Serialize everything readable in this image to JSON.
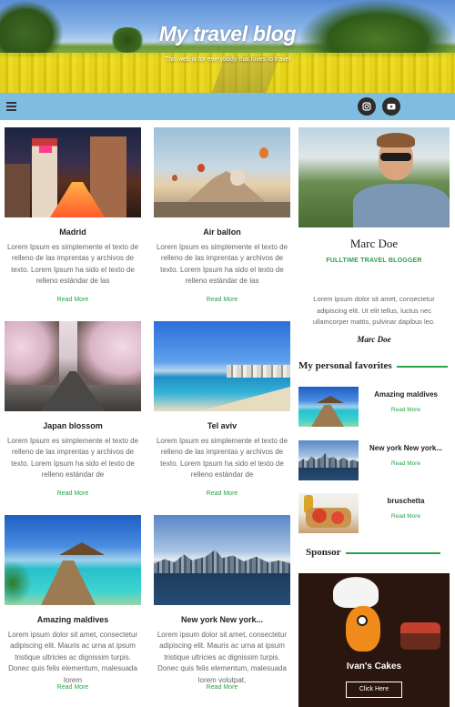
{
  "hero": {
    "title": "My travel blog",
    "subtitle": "This web is for everybody that loves to travel"
  },
  "nav": {
    "menu_icon": "hamburger-icon",
    "social": [
      {
        "name": "instagram",
        "icon": "instagram-icon"
      },
      {
        "name": "youtube",
        "icon": "youtube-icon"
      }
    ]
  },
  "posts": [
    {
      "title": "Madrid",
      "excerpt": "Lorem Ipsum es simplemente el texto de relleno de las imprentas y archivos de texto. Lorem Ipsum ha sido el texto de relleno estándar de las",
      "more": "Read More"
    },
    {
      "title": "Air ballon",
      "excerpt": "Lorem Ipsum es simplemente el texto de relleno de las imprentas y archivos de texto. Lorem Ipsum ha sido el texto de relleno estándar de las",
      "more": "Read More"
    },
    {
      "title": "Japan blossom",
      "excerpt": "Lorem Ipsum es simplemente el texto de relleno de las imprentas y archivos de texto. Lorem Ipsum ha sido el texto de relleno estándar de",
      "more": "Read More"
    },
    {
      "title": "Tel aviv",
      "excerpt": "Lorem Ipsum es simplemente el texto de relleno de las imprentas y archivos de texto. Lorem Ipsum ha sido el texto de relleno estándar de",
      "more": "Read More"
    },
    {
      "title": "Amazing maldives",
      "excerpt": "Lorem ipsum dolor sit amet, consectetur adipiscing elit. Mauris ac urna at ipsum tristique ultricies ac dignissim turpis. Donec quis felis elementum, malesuada lorem",
      "more": "Read More"
    },
    {
      "title": "New york New york...",
      "excerpt": "Lorem ipsum dolor sit amet, consectetur adipiscing elit. Mauris ac urna at ipsum tristique ultricies ac dignissim turpis. Donec quis felis elementum, malesuada lorem volutpat,",
      "more": "Read More"
    }
  ],
  "about": {
    "name": "Marc Doe",
    "tags": "FULLTIME  TRAVEL  BLOGGER",
    "text": "Lorem ipsum dolor sit amet, consectetur adipiscing elit. Ut elit tellus, luctus nec ullamcorper mattis, pulvinar dapibus leo.",
    "signature": "Marc Doe"
  },
  "favorites": {
    "heading": "My personal favorites",
    "items": [
      {
        "title": "Amazing maldives",
        "more": "Read More"
      },
      {
        "title": "New york New york...",
        "more": "Read More"
      },
      {
        "title": "bruschetta",
        "more": "Read More"
      }
    ]
  },
  "sponsor": {
    "heading": "Sponsor",
    "name": "Ivan's Cakes",
    "button": "Click Here"
  },
  "colors": {
    "accent": "#2aa34a",
    "navbar": "#7fbde0"
  }
}
